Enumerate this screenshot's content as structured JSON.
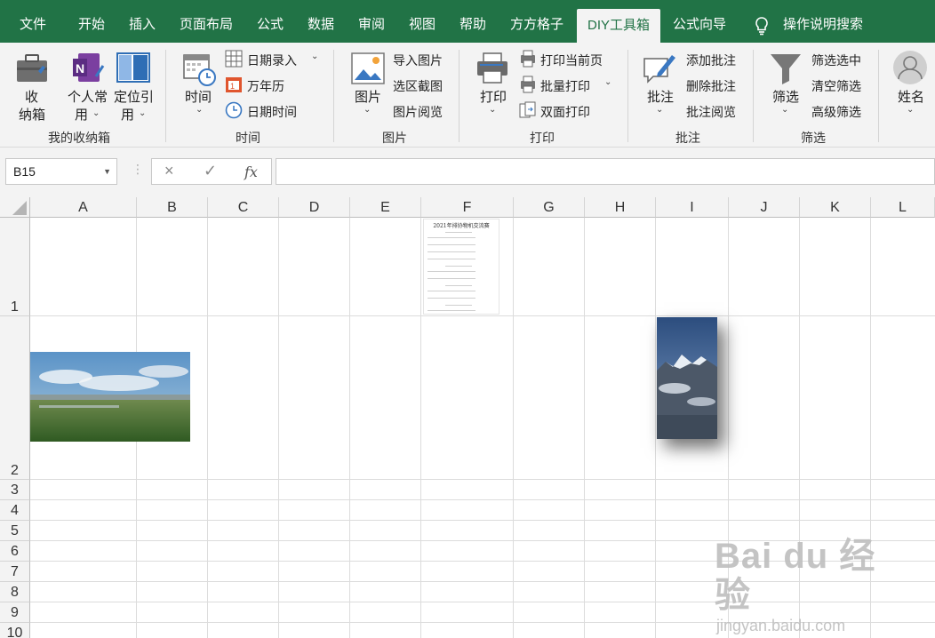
{
  "tabs": [
    "文件",
    "开始",
    "插入",
    "页面布局",
    "公式",
    "数据",
    "审阅",
    "视图",
    "帮助",
    "方方格子",
    "DIY工具箱",
    "公式向导"
  ],
  "active_tab": "DIY工具箱",
  "search": "操作说明搜索",
  "ribbon": {
    "shounaxiang": {
      "btn": "收纳箱",
      "btn_l1": "收",
      "btn_l2": "纳箱",
      "personal_l1": "个人常",
      "personal_l2": "用",
      "ref_l1": "定位引",
      "ref_l2": "用",
      "group": "我的收纳箱"
    },
    "time": {
      "btn": "时间",
      "date_entry": "日期录入",
      "calendar": "万年历",
      "datetime": "日期时间",
      "group": "时间"
    },
    "picture": {
      "btn": "图片",
      "import": "导入图片",
      "screenshot": "选区截图",
      "browse": "图片阅览",
      "group": "图片"
    },
    "print": {
      "btn": "打印",
      "current": "打印当前页",
      "batch": "批量打印",
      "duplex": "双面打印",
      "group": "打印"
    },
    "comment": {
      "btn": "批注",
      "add": "添加批注",
      "delete": "删除批注",
      "browse": "批注阅览",
      "group": "批注"
    },
    "filter": {
      "btn": "筛选",
      "selected": "筛选选中",
      "clear": "清空筛选",
      "advanced": "高级筛选",
      "group": "筛选"
    },
    "name": {
      "btn": "姓名"
    }
  },
  "formula_bar": {
    "name_box": "B15",
    "cancel_icon": "×",
    "enter_icon": "✓",
    "fx": "fx",
    "formula": ""
  },
  "columns": [
    "A",
    "B",
    "C",
    "D",
    "E",
    "F",
    "G",
    "H",
    "I",
    "J",
    "K",
    "L"
  ],
  "rows": [
    "1",
    "2",
    "3",
    "4",
    "5",
    "6",
    "7",
    "8",
    "9",
    "10"
  ],
  "doc_thumb_title": "2021年排协物机交流赛",
  "watermark": {
    "brand": "Bai du 经验",
    "url": "jingyan.baidu.com"
  },
  "colors": {
    "excel_green": "#217346",
    "ribbon_bg": "#f3f3f3"
  },
  "icons": [
    "toolbox-icon",
    "onenote-icon",
    "layout-icon",
    "calendar-clock-icon",
    "table-icon",
    "calendar-icon",
    "clock-icon",
    "image-icon",
    "printer-icon",
    "print-page-icon",
    "duplex-print-icon",
    "comment-pen-icon",
    "funnel-icon",
    "user-avatar-icon",
    "lightbulb-icon"
  ]
}
